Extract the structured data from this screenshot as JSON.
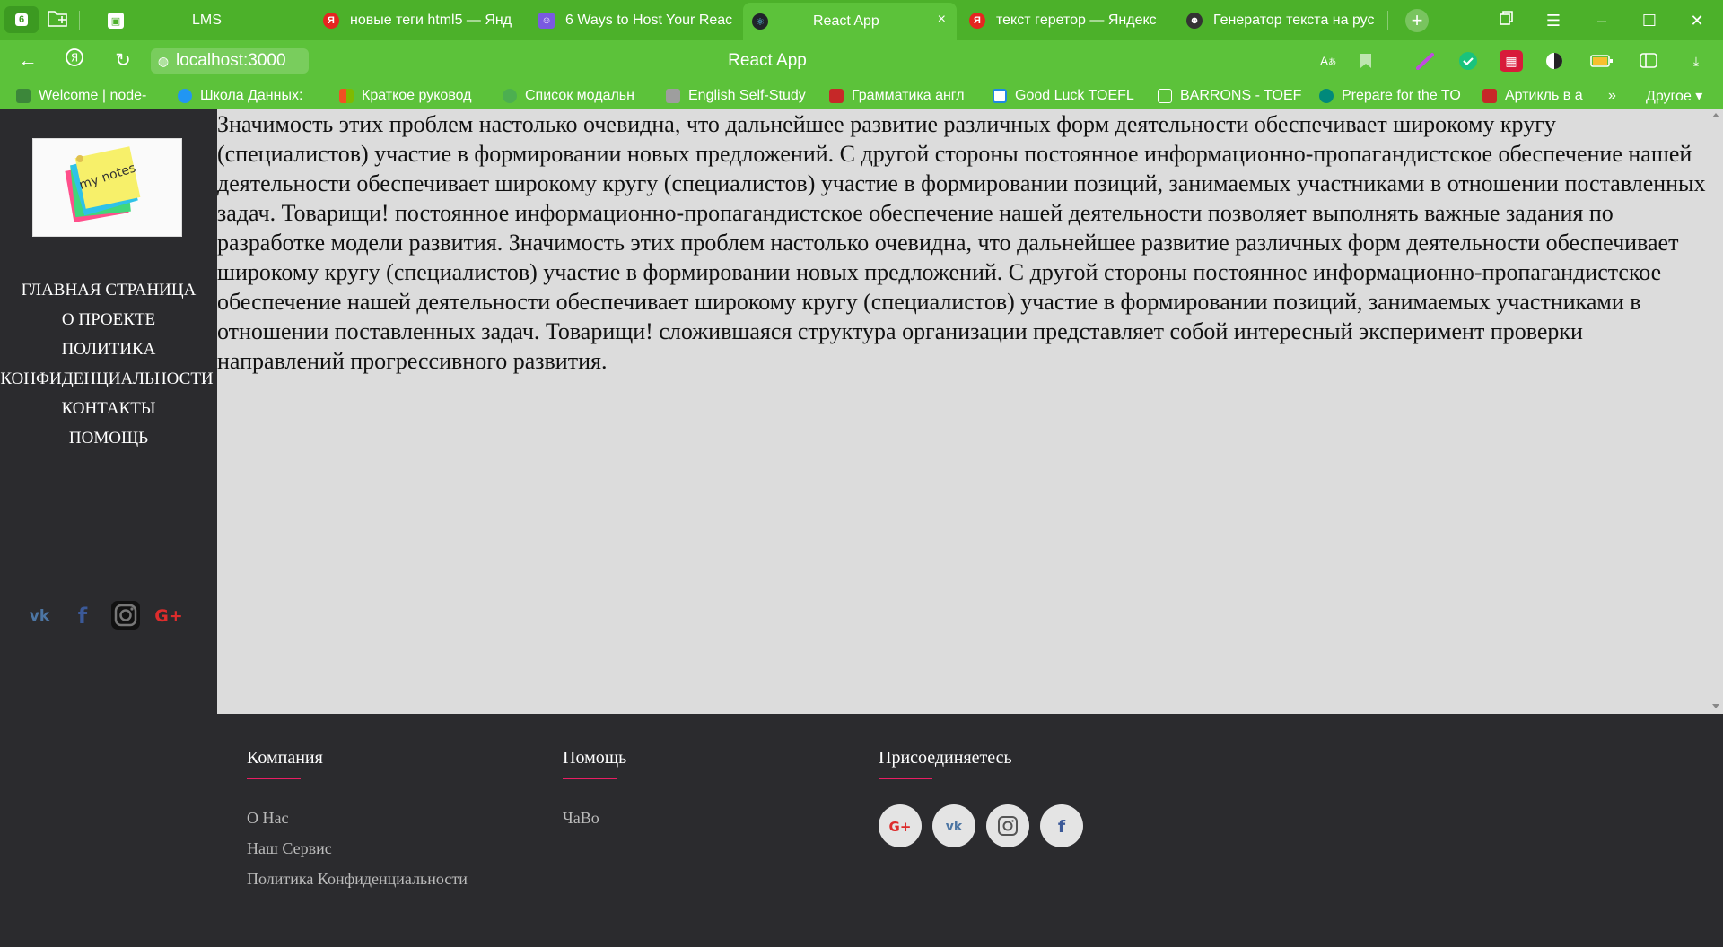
{
  "browser": {
    "tab_count": "6",
    "tabs": [
      {
        "title": "LMS",
        "favicon_color": "#ffffff"
      },
      {
        "title": "новые теги html5 — Янд",
        "favicon_color": "#e52620"
      },
      {
        "title": "6 Ways to Host Your Reac",
        "favicon_color": "#7a5ae0"
      },
      {
        "title": "React App",
        "favicon_color": "#20232a"
      },
      {
        "title": "текст гeретор — Яндекс",
        "favicon_color": "#e52620"
      },
      {
        "title": "Генератор текста на рус",
        "favicon_color": "#333333"
      }
    ],
    "tab_close": "×",
    "new_tab": "+",
    "url": "localhost:3000",
    "page_title": "React App",
    "bookmarks": [
      {
        "label": "Welcome | node-",
        "color": "#3c873a"
      },
      {
        "label": "Школа Данных: ",
        "color": "#2196f3"
      },
      {
        "label": "Краткое руковод",
        "color": "#f25022"
      },
      {
        "label": "Список модальн",
        "color": "#4caf50"
      },
      {
        "label": "English Self-Study",
        "color": "#9e9e9e"
      },
      {
        "label": "Грамматика англ",
        "color": "#c62828"
      },
      {
        "label": "Good Luck TOEFL",
        "color": "#1e88e5"
      },
      {
        "label": "BARRONS - TOEFL",
        "color": "#ffffff"
      },
      {
        "label": "Prepare for the TO",
        "color": "#00897b"
      },
      {
        "label": "Артикль в а",
        "color": "#c62828"
      }
    ],
    "bookmarks_more": "»",
    "bookmarks_other": "Другое ▾"
  },
  "sidebar": {
    "logo_text": "my notes",
    "nav": [
      "ГЛАВНАЯ СТРАНИЦА",
      "О ПРОЕКТЕ",
      "ПОЛИТИКА",
      "КОНФИДЕНЦИАЛЬНОСТИ",
      "КОНТАКТЫ",
      "ПОМОЩЬ"
    ],
    "social_icons": [
      "vk-icon",
      "facebook-icon",
      "instagram-icon",
      "google-plus-icon"
    ]
  },
  "content": {
    "text": "Значимость этих проблем настолько очевидна, что дальнейшее развитие различных форм деятельности обеспечивает широкому кругу (специалистов) участие в формировании новых предложений. С другой стороны постоянное информационно-пропагандистское обеспечение нашей деятельности обеспечивает широкому кругу (специалистов) участие в формировании позиций, занимаемых участниками в отношении поставленных задач. Товарищи! постоянное информационно-пропагандистское обеспечение нашей деятельности позволяет выполнять важные задания по разработке модели развития. Значимость этих проблем настолько очевидна, что дальнейшее развитие различных форм деятельности обеспечивает широкому кругу (специалистов) участие в формировании новых предложений. С другой стороны постоянное информационно-пропагандистское обеспечение нашей деятельности обеспечивает широкому кругу (специалистов) участие в формировании позиций, занимаемых участниками в отношении поставленных задач. Товарищи! сложившаяся структура организации представляет собой интересный эксперимент проверки направлений прогрессивного развития."
  },
  "footer": {
    "company": {
      "title": "Компания",
      "links": [
        "О Нас",
        "Наш Сервис",
        "Политика Конфиденциальности"
      ]
    },
    "help": {
      "title": "Помощь",
      "links": [
        "ЧаВо"
      ]
    },
    "join": {
      "title": "Присоединяетесь",
      "icons": [
        "google-plus-icon",
        "vk-icon",
        "instagram-icon",
        "facebook-icon"
      ]
    },
    "accent_color": "#e91e63"
  },
  "colors": {
    "browser_green": "#4cb12a",
    "sidebar_bg": "#2b2b2e",
    "content_bg": "#dcdcdc"
  }
}
